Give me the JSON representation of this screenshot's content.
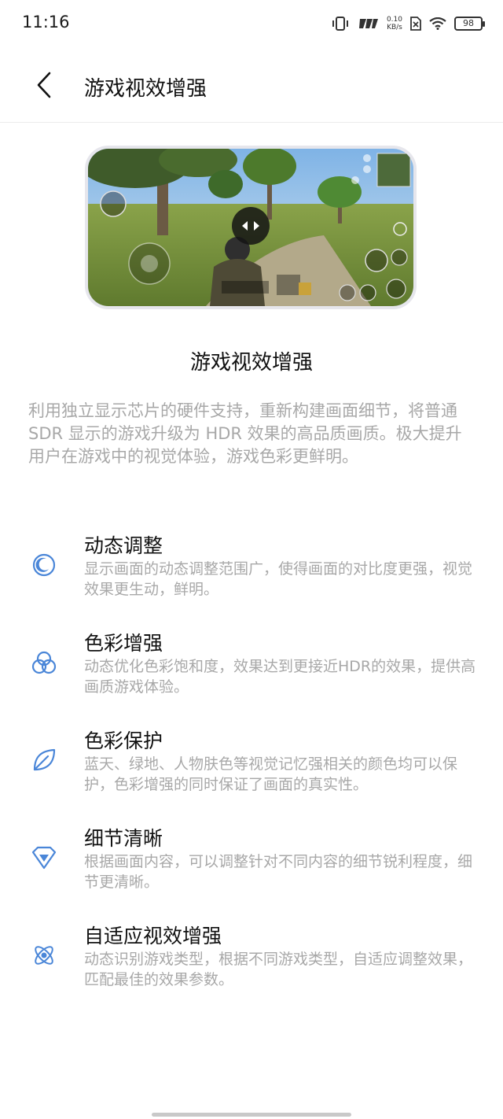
{
  "status_bar": {
    "time": "11:16",
    "net_speed_value": "0.10",
    "net_speed_unit": "KB/s",
    "battery": "98"
  },
  "header": {
    "title": "游戏视效增强"
  },
  "intro": {
    "title": "游戏视效增强",
    "description": "利用独立显示芯片的硬件支持，重新构建画面细节，将普通 SDR 显示的游戏升级为 HDR 效果的高品质画质。极大提升用户在游戏中的视觉体验，游戏色彩更鲜明。"
  },
  "features": [
    {
      "title": "动态调整",
      "description": "显示画面的动态调整范围广，使得画面的对比度更强，视觉效果更生动，鲜明。",
      "icon": "moon-icon"
    },
    {
      "title": "色彩增强",
      "description": "动态优化色彩饱和度，效果达到更接近HDR的效果，提供高画质游戏体验。",
      "icon": "color-circles-icon"
    },
    {
      "title": "色彩保护",
      "description": "蓝天、绿地、人物肤色等视觉记忆强相关的颜色均可以保护，色彩增强的同时保证了画面的真实性。",
      "icon": "leaf-icon"
    },
    {
      "title": "细节清晰",
      "description": "根据画面内容，可以调整针对不同内容的细节锐利程度，细节更清晰。",
      "icon": "diamond-icon"
    },
    {
      "title": "自适应视效增强",
      "description": "动态识别游戏类型，根据不同游戏类型，自适应调整效果，匹配最佳的效果参数。",
      "icon": "atom-icon"
    }
  ],
  "colors": {
    "accent": "#4a86d8",
    "text_primary": "#111111",
    "text_secondary": "#a8a8a8"
  }
}
